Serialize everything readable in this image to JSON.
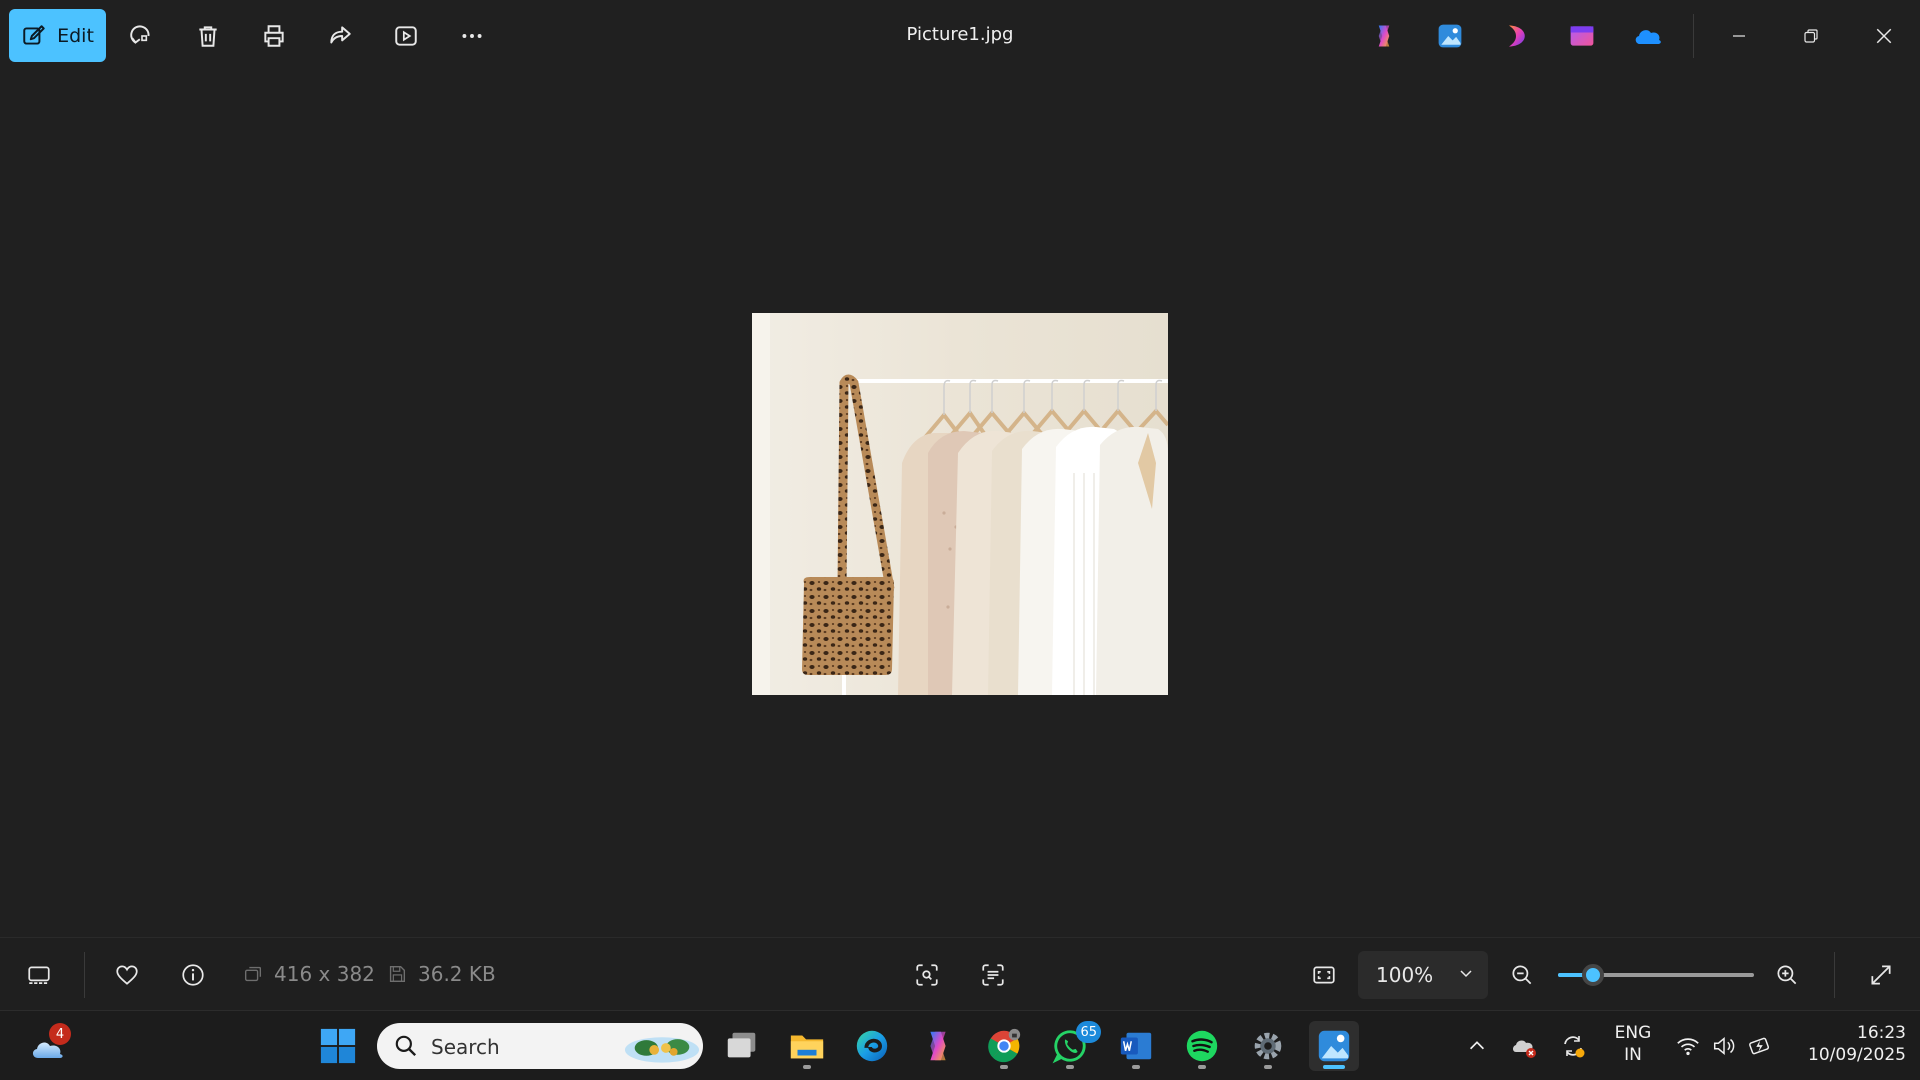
{
  "window": {
    "title": "Picture1.jpg",
    "edit_label": "Edit"
  },
  "toolbar_icons": [
    "rotate-icon",
    "delete-icon",
    "print-icon",
    "share-icon",
    "slideshow-icon",
    "more-icon"
  ],
  "header_apps": [
    "copilot-icon",
    "photos-icon",
    "clipchamp-icon",
    "designer-icon",
    "onedrive-icon"
  ],
  "image_info": {
    "dimensions": "416 x 382",
    "file_size": "36.2 KB"
  },
  "zoom": {
    "level_label": "100%",
    "slider_fraction": 0.18
  },
  "taskbar": {
    "search_placeholder": "Search",
    "weather_badge": "4",
    "whatsapp_badge": "65",
    "language_line1": "ENG",
    "language_line2": "IN",
    "time": "16:23",
    "date": "10/09/2025"
  },
  "colors": {
    "accent": "#4cc2ff",
    "background": "#202020",
    "badge_red": "#c42b1c",
    "badge_blue": "#1c8adb"
  }
}
